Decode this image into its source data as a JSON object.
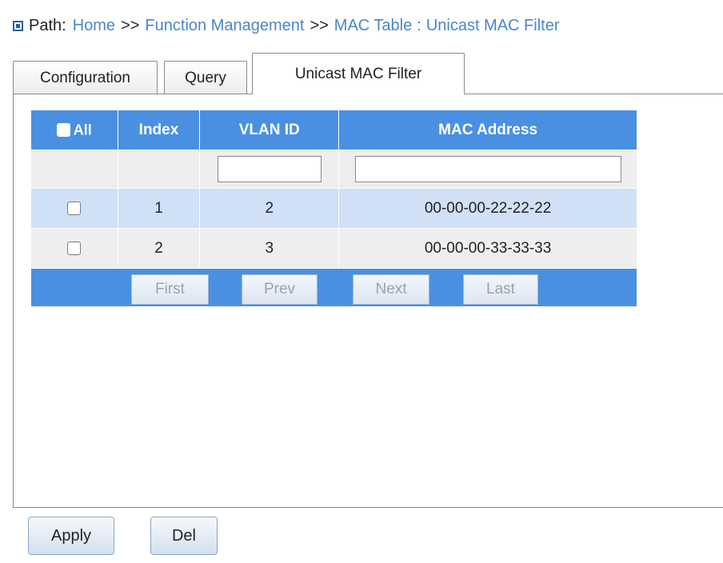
{
  "breadcrumb": {
    "label": "Path:",
    "home": "Home",
    "sep1": ">>",
    "function_management": "Function Management",
    "sep2": ">>",
    "mac_table": "MAC Table",
    "colon": ":",
    "current": "Unicast MAC Filter"
  },
  "tabs": [
    {
      "label": "Configuration",
      "active": false
    },
    {
      "label": "Query",
      "active": false
    },
    {
      "label": "Unicast MAC Filter",
      "active": true
    }
  ],
  "table": {
    "headers": {
      "all": "All",
      "index": "Index",
      "vlan_id": "VLAN ID",
      "mac_address": "MAC Address"
    },
    "filter": {
      "vlan_id": "",
      "mac_address": ""
    },
    "rows": [
      {
        "index": "1",
        "vlan_id": "2",
        "mac": "00-00-00-22-22-22",
        "checked": false
      },
      {
        "index": "2",
        "vlan_id": "3",
        "mac": "00-00-00-33-33-33",
        "checked": false
      }
    ],
    "nav": {
      "first": "First",
      "prev": "Prev",
      "next": "Next",
      "last": "Last"
    }
  },
  "buttons": {
    "apply": "Apply",
    "del": "Del"
  },
  "colors": {
    "header": "#4a90e2",
    "row_highlight": "#cfe0f7",
    "row_alt": "#eeeeee",
    "link": "#4a86c8"
  }
}
